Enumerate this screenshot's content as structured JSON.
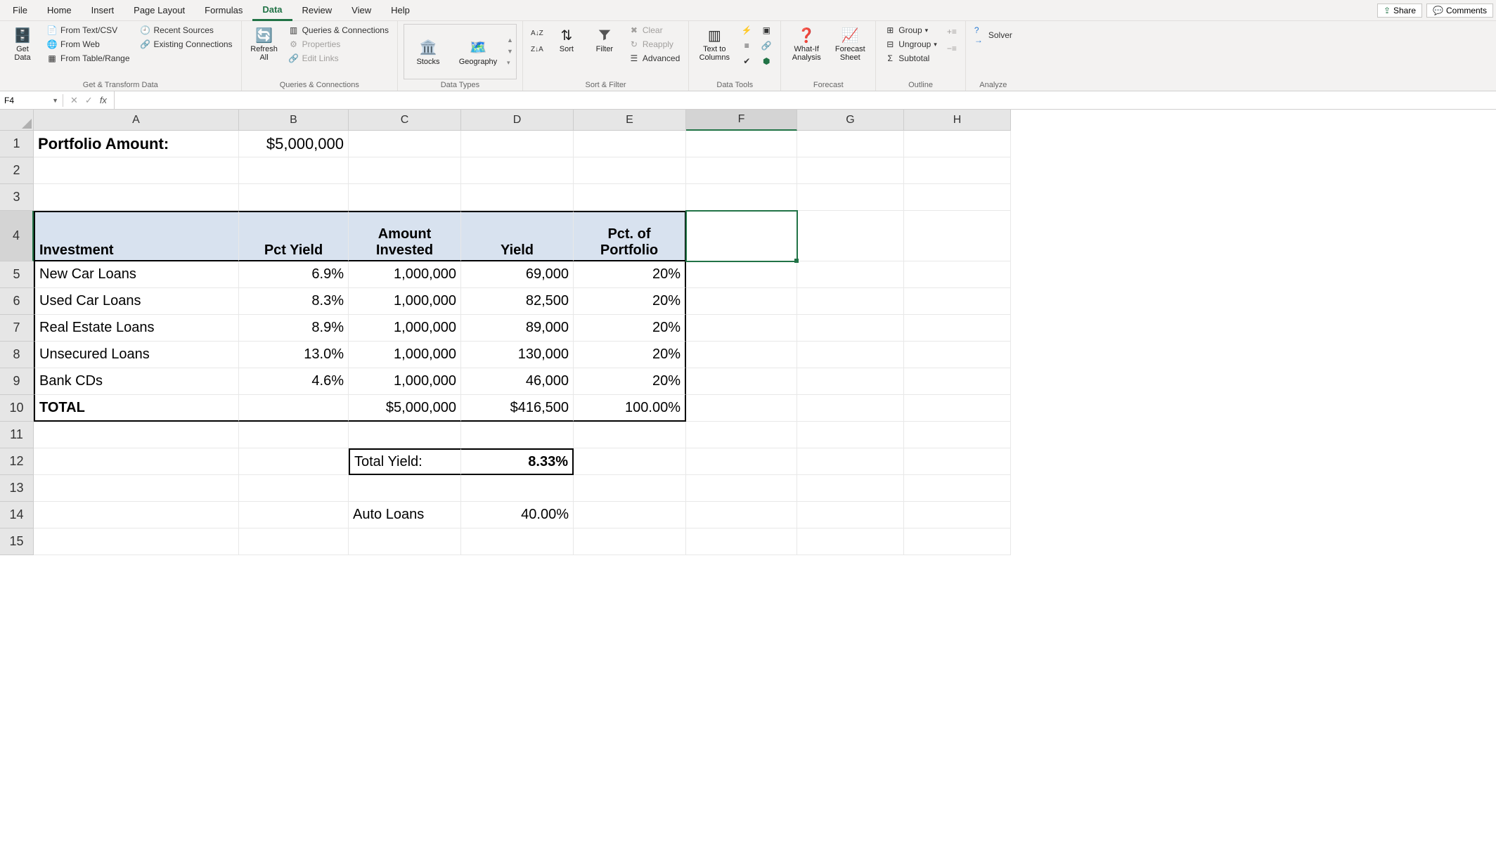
{
  "menu": {
    "tabs": [
      "File",
      "Home",
      "Insert",
      "Page Layout",
      "Formulas",
      "Data",
      "Review",
      "View",
      "Help"
    ],
    "active": "Data",
    "share": "Share",
    "comments": "Comments"
  },
  "ribbon": {
    "g1": {
      "getdata": "Get\nData",
      "t1": "From Text/CSV",
      "t2": "From Web",
      "t3": "From Table/Range",
      "t4": "Recent Sources",
      "t5": "Existing Connections",
      "label": "Get & Transform Data"
    },
    "g2": {
      "refresh": "Refresh\nAll",
      "q": "Queries & Connections",
      "p": "Properties",
      "e": "Edit Links",
      "label": "Queries & Connections"
    },
    "g3": {
      "stocks": "Stocks",
      "geo": "Geography",
      "label": "Data Types"
    },
    "g4": {
      "sort": "Sort",
      "filter": "Filter",
      "clear": "Clear",
      "reapply": "Reapply",
      "adv": "Advanced",
      "label": "Sort & Filter"
    },
    "g5": {
      "ttc": "Text to\nColumns",
      "label": "Data Tools"
    },
    "g6": {
      "wia": "What-If\nAnalysis",
      "fs": "Forecast\nSheet",
      "label": "Forecast"
    },
    "g7": {
      "grp": "Group",
      "ung": "Ungroup",
      "sub": "Subtotal",
      "label": "Outline"
    },
    "g8": {
      "solver": "Solver",
      "label": "Analyze"
    }
  },
  "namebox": "F4",
  "formula": "",
  "cols": [
    "A",
    "B",
    "C",
    "D",
    "E",
    "F",
    "G",
    "H"
  ],
  "rows": [
    "1",
    "2",
    "3",
    "4",
    "5",
    "6",
    "7",
    "8",
    "9",
    "10",
    "11",
    "12",
    "13",
    "14",
    "15"
  ],
  "cells": {
    "A1": "Portfolio Amount:",
    "B1": "$5,000,000",
    "A4": "Investment",
    "B4": "Pct Yield",
    "C4": "Amount\nInvested",
    "D4": "Yield",
    "E4": "Pct. of\nPortfolio",
    "A5": "New Car Loans",
    "B5": "6.9%",
    "C5": "1,000,000",
    "D5": "69,000",
    "E5": "20%",
    "A6": "Used Car Loans",
    "B6": "8.3%",
    "C6": "1,000,000",
    "D6": "82,500",
    "E6": "20%",
    "A7": "Real Estate Loans",
    "B7": "8.9%",
    "C7": "1,000,000",
    "D7": "89,000",
    "E7": "20%",
    "A8": "Unsecured Loans",
    "B8": "13.0%",
    "C8": "1,000,000",
    "D8": "130,000",
    "E8": "20%",
    "A9": "Bank CDs",
    "B9": "4.6%",
    "C9": "1,000,000",
    "D9": "46,000",
    "E9": "20%",
    "A10": "TOTAL",
    "C10": "$5,000,000",
    "D10": "$416,500",
    "E10": "100.00%",
    "C12": "Total Yield:",
    "D12": "8.33%",
    "C14": "Auto Loans",
    "D14": "40.00%"
  },
  "chart_data": {
    "type": "table",
    "title": "Portfolio Allocation",
    "portfolio_amount": 5000000,
    "columns": [
      "Investment",
      "Pct Yield",
      "Amount Invested",
      "Yield",
      "Pct. of Portfolio"
    ],
    "rows": [
      {
        "Investment": "New Car Loans",
        "Pct Yield": 0.069,
        "Amount Invested": 1000000,
        "Yield": 69000,
        "Pct. of Portfolio": 0.2
      },
      {
        "Investment": "Used Car Loans",
        "Pct Yield": 0.083,
        "Amount Invested": 1000000,
        "Yield": 82500,
        "Pct. of Portfolio": 0.2
      },
      {
        "Investment": "Real Estate Loans",
        "Pct Yield": 0.089,
        "Amount Invested": 1000000,
        "Yield": 89000,
        "Pct. of Portfolio": 0.2
      },
      {
        "Investment": "Unsecured Loans",
        "Pct Yield": 0.13,
        "Amount Invested": 1000000,
        "Yield": 130000,
        "Pct. of Portfolio": 0.2
      },
      {
        "Investment": "Bank CDs",
        "Pct Yield": 0.046,
        "Amount Invested": 1000000,
        "Yield": 46000,
        "Pct. of Portfolio": 0.2
      }
    ],
    "totals": {
      "Amount Invested": 5000000,
      "Yield": 416500,
      "Pct. of Portfolio": 1.0
    },
    "total_yield": 0.0833,
    "auto_loans_pct": 0.4
  }
}
